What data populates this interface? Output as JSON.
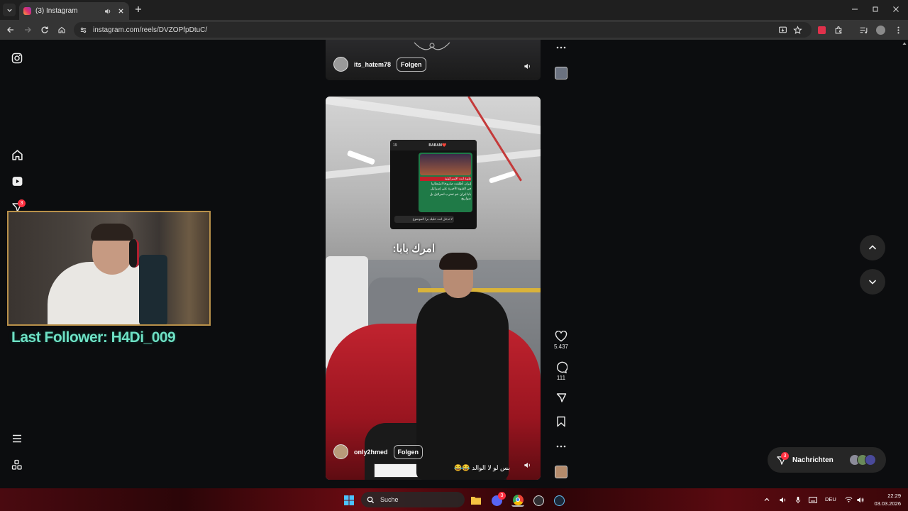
{
  "browser": {
    "tab_title": "(3) Instagram",
    "url": "instagram.com/reels/DVZOPfpDtuC/"
  },
  "sidebar": {
    "notifications_badge": "3"
  },
  "overlay": {
    "last_follower": "Last Follower: H4Di_009"
  },
  "reels": [
    {
      "username": "its_hatem78",
      "follow_label": "Folgen"
    },
    {
      "username": "only2hmed",
      "follow_label": "Folgen",
      "caption": "بس لو لا الوالد 😂😂",
      "overlay_text": "امرك بابا:",
      "likes": "5.437",
      "comments": "111",
      "chat_header": "BABAM❤️",
      "chat_time": "19",
      "chat_lines": [
        "ظبية انت الإسرائيلية",
        "إيران أطلقت صاروخا انشطاريا",
        "في القنوة الأخيرة على إسرائيل",
        "بابا ايران عم تضرب اسرائيل بل صواريخ",
        "لا تدخل انت خليك برا الموضوع"
      ]
    }
  ],
  "messages": {
    "label": "Nachrichten",
    "badge": "3"
  },
  "taskbar": {
    "search_label": "Suche",
    "discord_badge": "3",
    "language": "DEU",
    "time": "22:29",
    "date": "03.03.2026"
  },
  "colors": {
    "accent_follower": "#6ee0c4",
    "badge": "#ff3040",
    "webcam_border": "#b9914a"
  }
}
